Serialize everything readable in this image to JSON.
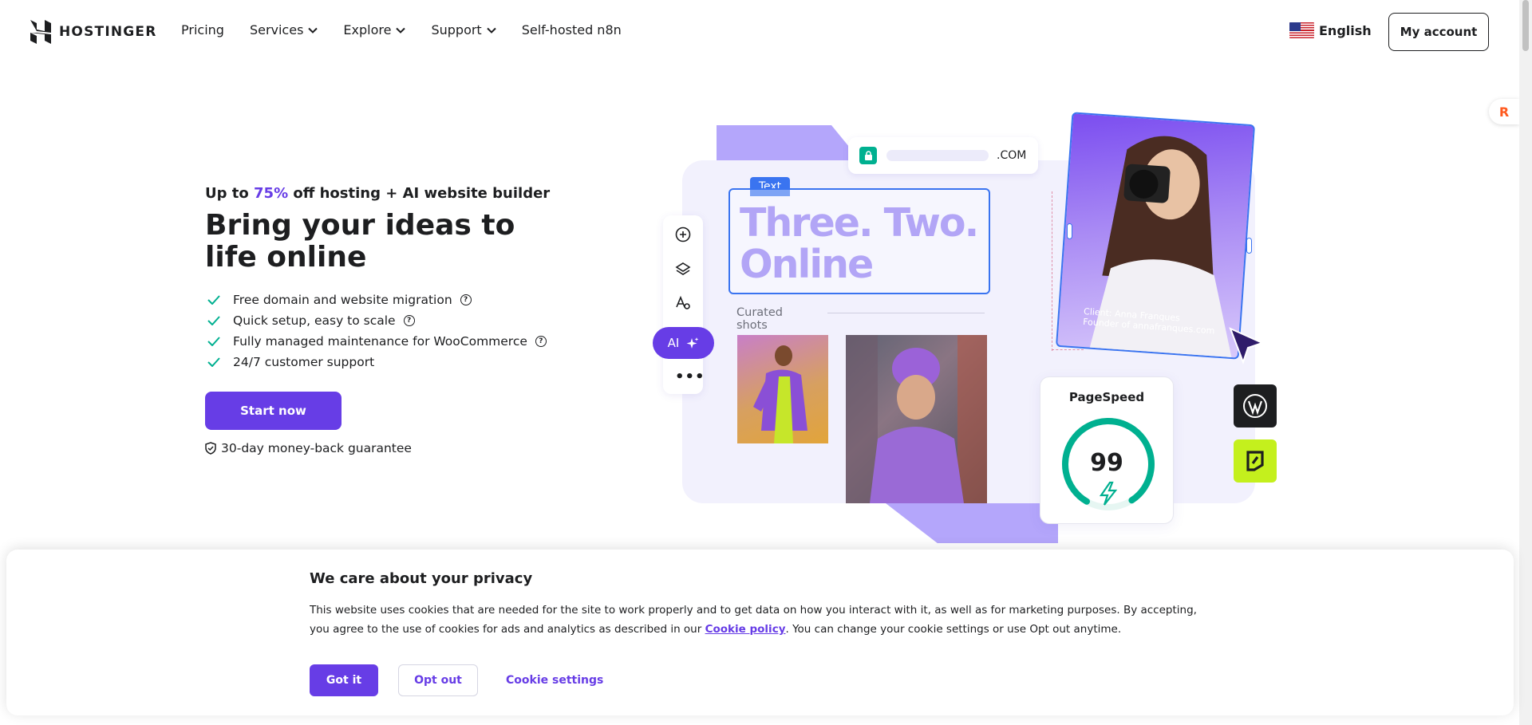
{
  "header": {
    "logo_text": "HOSTINGER",
    "nav": [
      {
        "label": "Pricing",
        "has_dropdown": false
      },
      {
        "label": "Services",
        "has_dropdown": true
      },
      {
        "label": "Explore",
        "has_dropdown": true
      },
      {
        "label": "Support",
        "has_dropdown": true
      },
      {
        "label": "Self-hosted n8n",
        "has_dropdown": false
      }
    ],
    "language": "English",
    "account_label": "My account"
  },
  "hero": {
    "eyebrow_prefix": "Up to ",
    "eyebrow_accent": "75%",
    "eyebrow_suffix": " off hosting + AI website builder",
    "title": "Bring your ideas to life online",
    "features": [
      {
        "text": "Free domain and website migration",
        "help": true
      },
      {
        "text": "Quick setup, easy to scale",
        "help": true
      },
      {
        "text": "Fully managed maintenance for WooCommerce",
        "help": true
      },
      {
        "text": "24/7 customer support",
        "help": false
      }
    ],
    "cta_label": "Start now",
    "guarantee": "30-day money-back guarantee"
  },
  "illustration": {
    "url_tld": ".COM",
    "text_tag": "Text",
    "headline_line1": "Three. Two.",
    "headline_line2": "Online",
    "ai_label": "AI",
    "curated_label": "Curated shots",
    "caption_line1": "Client: Anna Franques",
    "caption_line2": "Founder of annafranques.com",
    "pagespeed_title": "PageSpeed",
    "pagespeed_score": "99",
    "pagespeed_fraction": 0.99
  },
  "cookie": {
    "title": "We care about your privacy",
    "text_before": "This website uses cookies that are needed for the site to work properly and to get data on how you interact with it, as well as for marketing purposes. By accepting, you agree to the use of cookies for ads and analytics as described in our ",
    "link_label": "Cookie policy",
    "text_after": ". You can change your cookie settings or use Opt out anytime.",
    "accept_label": "Got it",
    "optout_label": "Opt out",
    "settings_label": "Cookie settings"
  },
  "colors": {
    "brand": "#673de6",
    "accent_green": "#00b090",
    "deco_lavender": "#b4a6fb",
    "panel_bg": "#f2f1fd"
  },
  "icons": [
    "hostinger-logo-icon",
    "chevron-down-icon",
    "us-flag-icon",
    "check-icon",
    "help-icon",
    "shield-check-icon",
    "lock-icon",
    "add-circle-icon",
    "layers-icon",
    "font-style-icon",
    "sparkle-icon",
    "more-icon",
    "cursor-icon",
    "bolt-icon",
    "wordpress-icon",
    "brand-logo-icon"
  ]
}
